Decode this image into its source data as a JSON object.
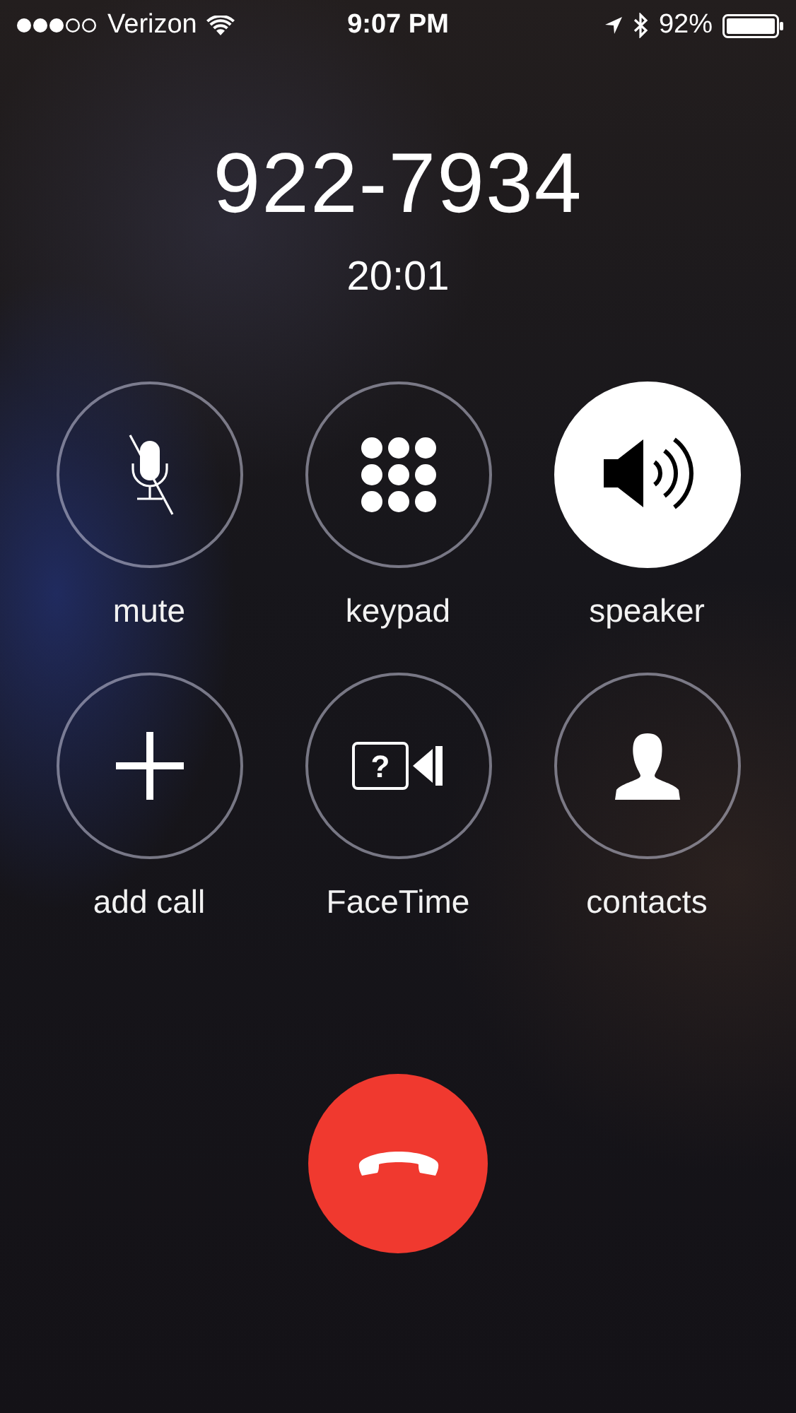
{
  "status_bar": {
    "carrier": "Verizon",
    "time": "9:07 PM",
    "battery": "92%"
  },
  "call": {
    "number": "922-7934",
    "duration": "20:01"
  },
  "buttons": [
    {
      "kind": "mute",
      "label": "mute",
      "selected": false
    },
    {
      "kind": "keypad",
      "label": "keypad",
      "selected": false
    },
    {
      "kind": "speaker",
      "label": "speaker",
      "selected": true
    },
    {
      "kind": "add",
      "label": "add call",
      "selected": false
    },
    {
      "kind": "facetime",
      "label": "FaceTime",
      "selected": false,
      "icon_text": "?"
    },
    {
      "kind": "contacts",
      "label": "contacts",
      "selected": false
    }
  ]
}
